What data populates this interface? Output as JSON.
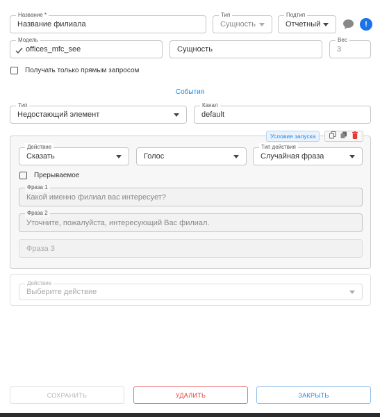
{
  "name_field": {
    "label": "Название *",
    "value": "Название филиала"
  },
  "type_field": {
    "label": "Тип",
    "value": "Сущность"
  },
  "subtype_field": {
    "label": "Подтип",
    "value": "Отчетный"
  },
  "info_badge": "!",
  "model_field": {
    "label": "Модель",
    "value": "offices_mfc_see"
  },
  "entity_field": {
    "value": "Сущность"
  },
  "weight_field": {
    "label": "Вес",
    "value": "3"
  },
  "direct_request": {
    "label": "Получать только прямым запросом",
    "checked": false
  },
  "events_link": "События",
  "event_type": {
    "label": "Тип",
    "value": "Недостающий элемент"
  },
  "channel": {
    "label": "Канал",
    "value": "default"
  },
  "conditions_button": "Условия запуска",
  "action_panel": {
    "action": {
      "label": "Действие",
      "value": "Сказать"
    },
    "voice": {
      "value": "Голос"
    },
    "action_type": {
      "label": "Тип действия",
      "value": "Случайная фраза"
    },
    "interruptible": {
      "label": "Прерываемое",
      "checked": false
    },
    "phrases": [
      {
        "label": "Фраза 1",
        "value": "Какой именно филиал вас интересует?"
      },
      {
        "label": "Фраза 2",
        "value": "Уточните, пожалуйста, интересующий Вас филиал."
      },
      {
        "placeholder": "Фраза 3"
      }
    ]
  },
  "new_action": {
    "label": "Действие",
    "placeholder": "Выберите действие"
  },
  "footer": {
    "save": "СОХРАНИТЬ",
    "delete": "УДАЛИТЬ",
    "close": "ЗАКРЫТЬ"
  },
  "colors": {
    "accent": "#1a73e8",
    "danger": "#e53935",
    "link": "#1e88e5"
  }
}
